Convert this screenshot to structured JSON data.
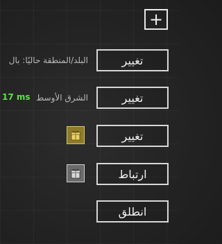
{
  "toolbar": {
    "add_symbol": "+"
  },
  "rows": [
    {
      "button": "تغيير",
      "label": "البلد/المنطقة حاليًا: بال"
    },
    {
      "button": "تغيير",
      "label": "الشرق الأوسط",
      "ping": "17 ms"
    },
    {
      "button": "تغيير",
      "icon": "gift-icon-gold"
    },
    {
      "button": "ارتباط",
      "icon": "gift-icon-grey"
    },
    {
      "button": "انطلق"
    }
  ],
  "colors": {
    "ping": "#5ee04a",
    "gold": "#8e7b2a",
    "border": "#d8d8d8"
  }
}
